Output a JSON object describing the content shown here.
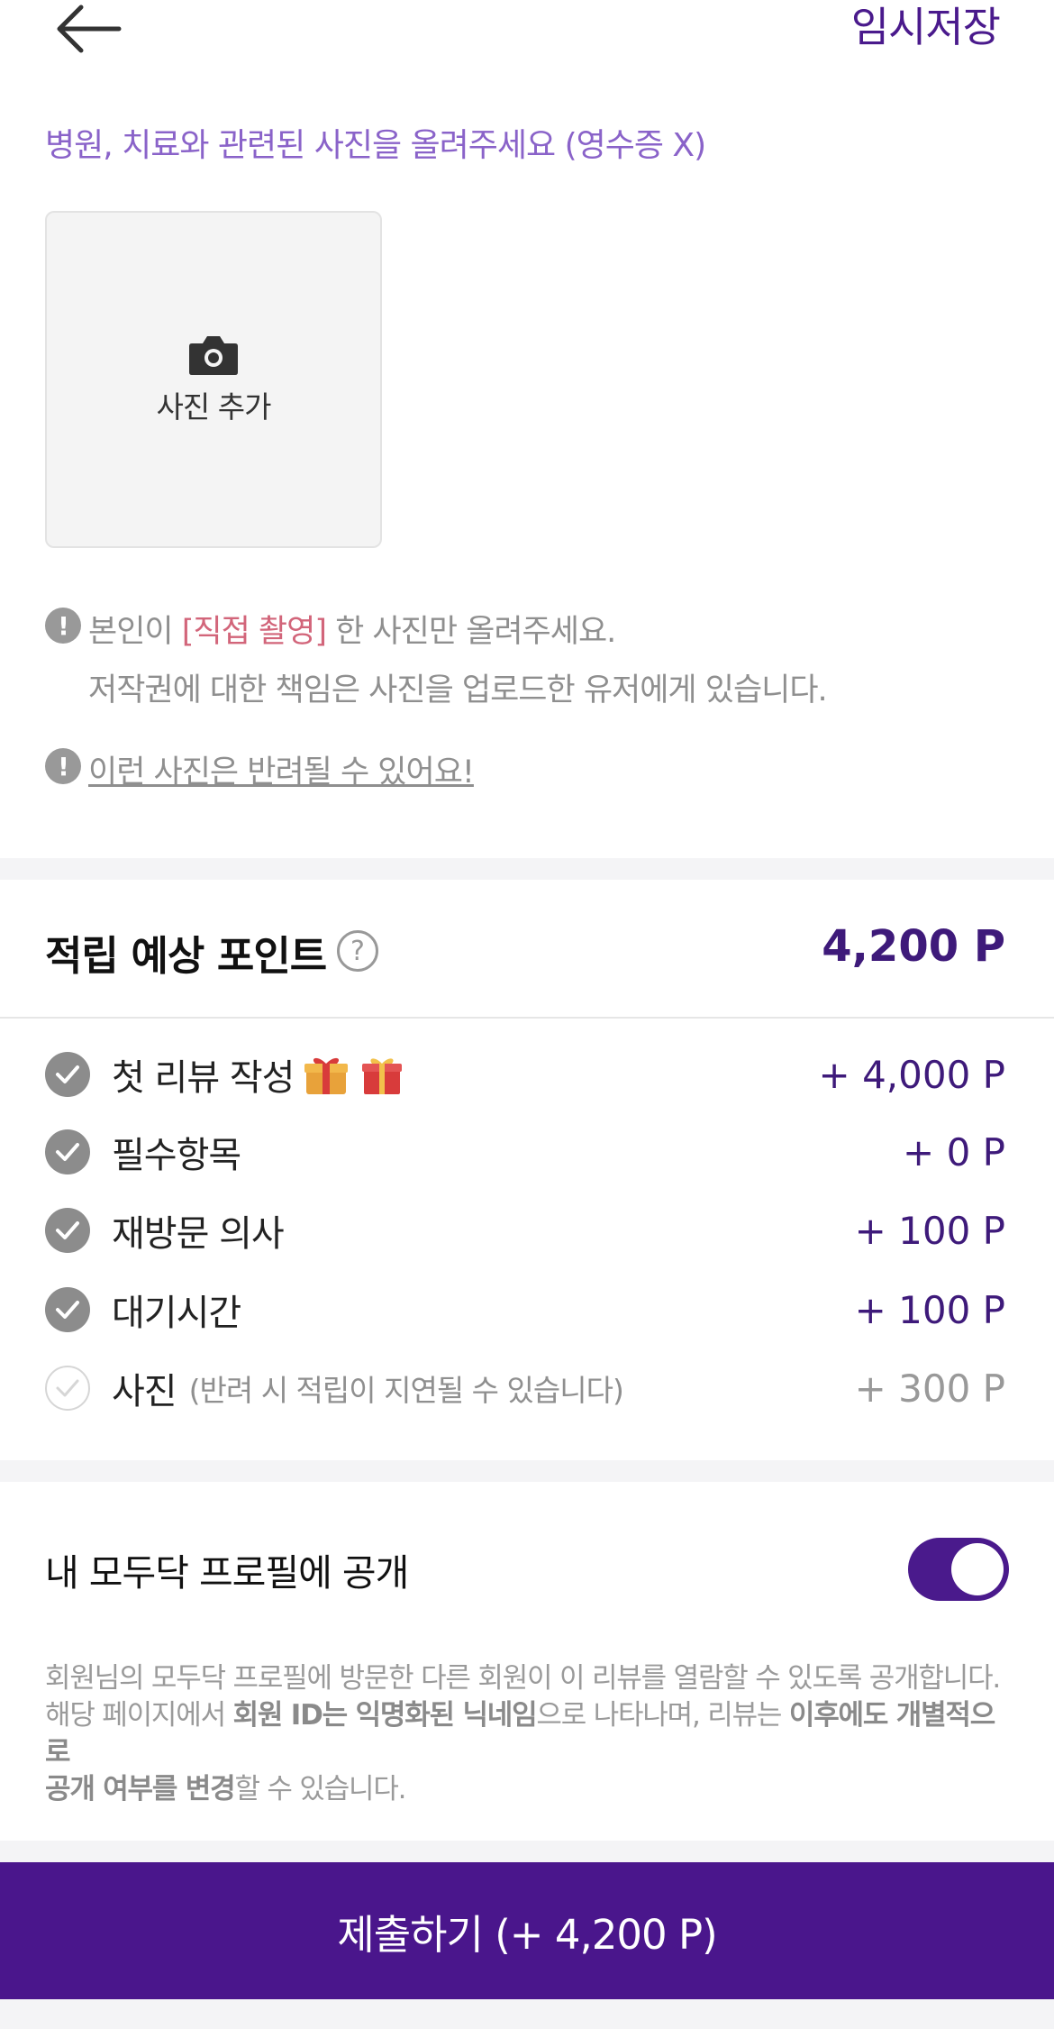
{
  "header": {
    "back_icon": "back-arrow-icon",
    "save_label": "임시저장"
  },
  "photo": {
    "hint": "병원, 치료와 관련된 사진을 올려주세요 (영수증 X)",
    "add_label": "사진 추가",
    "add_icon": "camera-icon"
  },
  "notices": {
    "first_pre": "본인이 ",
    "first_highlight": "[직접 촬영]",
    "first_post": " 한 사진만 올려주세요.",
    "first_line2": "저작권에 대한 책임은 사진을 업로드한 유저에게 있습니다.",
    "second": "이런 사진은 반려될 수 있어요!"
  },
  "points": {
    "title": "적립 예상 포인트",
    "help_icon": "?",
    "total": "4,200 P",
    "rows": [
      {
        "label": "첫 리뷰 작성",
        "value": "+ 4,000 P",
        "checked": true,
        "note": ""
      },
      {
        "label": "필수항목",
        "value": "+ 0 P",
        "checked": true,
        "note": ""
      },
      {
        "label": "재방문 의사",
        "value": "+ 100 P",
        "checked": true,
        "note": ""
      },
      {
        "label": "대기시간",
        "value": "+ 100 P",
        "checked": true,
        "note": ""
      },
      {
        "label": "사진",
        "value": "+ 300 P",
        "checked": false,
        "note": "(반려 시 적립이 지연될 수 있습니다)"
      }
    ]
  },
  "profile": {
    "label": "내 모두닥 프로필에 공개",
    "toggle_on": true,
    "desc_1": "회원님의 모두닥 프로필에 방문한 다른 회원이 이 리뷰를 열람할 수 있도록 공개합니다.",
    "desc_2a": "해당 페이지에서 ",
    "desc_2b": "회원 ID는 익명화된 닉네임",
    "desc_2c": "으로 나타나며, 리뷰는 ",
    "desc_2d": "이후에도 개별적으로",
    "desc_3a": "공개 여부를 변경",
    "desc_3b": "할 수 있습니다."
  },
  "submit": {
    "label": "제출하기  (+ 4,200 P)"
  },
  "colors": {
    "brand": "#4a168c",
    "accent_text": "#3e1a7a",
    "hint": "#8a63c9",
    "highlight_red": "#d2657a"
  }
}
